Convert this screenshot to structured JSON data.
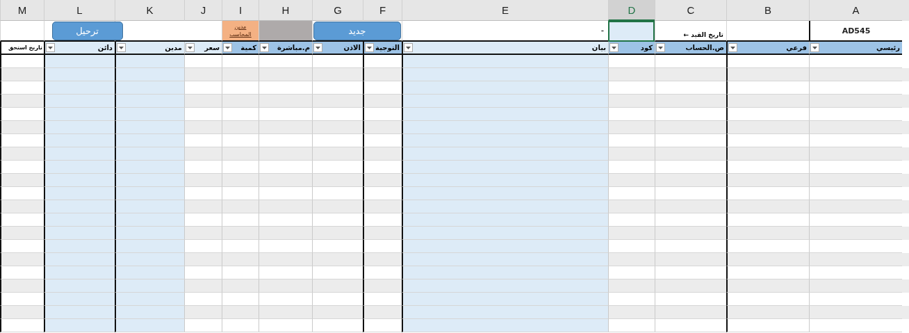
{
  "column_headers": [
    {
      "label": "A",
      "selected": false
    },
    {
      "label": "B",
      "selected": false
    },
    {
      "label": "C",
      "selected": false
    },
    {
      "label": "D",
      "selected": true
    },
    {
      "label": "E",
      "selected": false
    },
    {
      "label": "F",
      "selected": false
    },
    {
      "label": "G",
      "selected": false
    },
    {
      "label": "H",
      "selected": false
    },
    {
      "label": "I",
      "selected": false
    },
    {
      "label": "J",
      "selected": false
    },
    {
      "label": "K",
      "selected": false
    },
    {
      "label": "L",
      "selected": false
    },
    {
      "label": "M",
      "selected": false
    }
  ],
  "top_row": {
    "reference": "AD545",
    "date_label": "تاريخ القيد ←",
    "active_cell": {
      "selected": true
    },
    "description": "-",
    "new_button": "جديد",
    "accountant_note": "مدين المحاسب",
    "post_button": "ترحيل"
  },
  "table_headers": [
    {
      "label": "رئيسي",
      "filter": true
    },
    {
      "label": "فرعي",
      "filter": true
    },
    {
      "label": "ص.الحساب",
      "filter": true
    },
    {
      "label": "كود",
      "filter": true
    },
    {
      "label": "بيان",
      "filter": true
    },
    {
      "label": "التوجية",
      "filter": true
    },
    {
      "label": "الاذن",
      "filter": true
    },
    {
      "label": "م.مباشرة",
      "filter": true
    },
    {
      "label": "كمية",
      "filter": true
    },
    {
      "label": "سعر",
      "filter": true
    },
    {
      "label": "مدين",
      "filter": true
    },
    {
      "label": "دائن",
      "filter": true
    },
    {
      "label": "تاريخ استحق",
      "filter": false
    }
  ]
}
